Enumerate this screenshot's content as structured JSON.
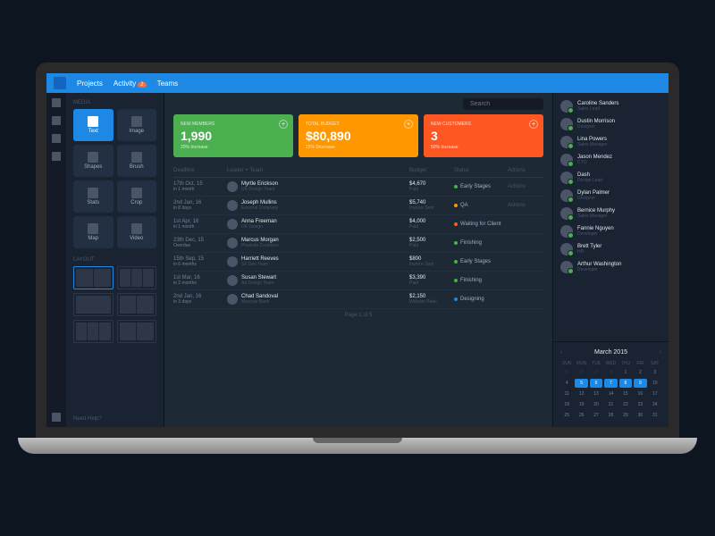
{
  "nav": {
    "items": [
      "Projects",
      "Activity",
      "Teams"
    ],
    "badge": "2"
  },
  "search": {
    "placeholder": "Search"
  },
  "tools": {
    "section": "Media",
    "items": [
      {
        "label": "Text",
        "active": true
      },
      {
        "label": "Image"
      },
      {
        "label": "Shapes"
      },
      {
        "label": "Brush"
      },
      {
        "label": "Stats"
      },
      {
        "label": "Crop"
      },
      {
        "label": "Map"
      },
      {
        "label": "Video"
      }
    ],
    "layoutSection": "Layout",
    "help": "Need Help?"
  },
  "cards": [
    {
      "label": "New Members",
      "value": "1,990",
      "trend": "20% Increase",
      "color": "green"
    },
    {
      "label": "Total Budget",
      "value": "$80,890",
      "trend": "15% Decrease",
      "color": "orange"
    },
    {
      "label": "New Customers",
      "value": "3",
      "trend": "50% Increase",
      "color": "red"
    }
  ],
  "table": {
    "headers": [
      "Deadline",
      "Leader + Team",
      "Budget",
      "Status",
      "Actions"
    ],
    "rows": [
      {
        "date": "17th Oct, 15",
        "sub": "in 1 month",
        "name": "Myrtle Erickson",
        "team": "UK Design Team",
        "budget": "$4,670",
        "bsub": "Paid",
        "status": "Early Stages",
        "dot": "#4caf50",
        "action": "Actions"
      },
      {
        "date": "2nd Jan, 16",
        "sub": "in 8 days",
        "name": "Joseph Mullins",
        "team": "External Company",
        "budget": "$5,740",
        "bsub": "Invoice Sent",
        "status": "QA",
        "dot": "#ff9800",
        "action": "Actions"
      },
      {
        "date": "1st Apr, 16",
        "sub": "in 1 month",
        "name": "Anna Freeman",
        "team": "UK Design",
        "budget": "$4,000",
        "bsub": "Paid",
        "status": "Waiting for Client",
        "dot": "#ff5722",
        "action": ""
      },
      {
        "date": "23th Dec, 15",
        "sub": "Overdue",
        "name": "Marcus Morgan",
        "team": "Pinacola Creatives",
        "budget": "$2,500",
        "bsub": "Paid",
        "status": "Finishing",
        "dot": "#4caf50",
        "action": ""
      },
      {
        "date": "15th Sep, 15",
        "sub": "in 6 months",
        "name": "Harriett Reeves",
        "team": "SF Dev Team",
        "budget": "$800",
        "bsub": "Invoice Sent",
        "status": "Early Stages",
        "dot": "#4caf50",
        "action": ""
      },
      {
        "date": "1st Mar, 16",
        "sub": "in 2 months",
        "name": "Susan Stewart",
        "team": "Ad Design Team",
        "budget": "$3,390",
        "bsub": "Paid",
        "status": "Finishing",
        "dot": "#4caf50",
        "action": ""
      },
      {
        "date": "2nd Jan, 16",
        "sub": "in 3 days",
        "name": "Chad Sandoval",
        "team": "Moscow Bank",
        "budget": "$2,150",
        "bsub": "Website Bank",
        "status": "Designing",
        "dot": "#1e88e5",
        "action": ""
      }
    ],
    "pager": "Page 1 of 5"
  },
  "members": [
    {
      "name": "Caroline Sanders",
      "role": "Sales Lead"
    },
    {
      "name": "Dustin Morrison",
      "role": "Designer"
    },
    {
      "name": "Lina Powers",
      "role": "Sales Manager"
    },
    {
      "name": "Jason Mendez",
      "role": "CTO"
    },
    {
      "name": "Dash",
      "role": "Design Lead"
    },
    {
      "name": "Dylan Palmer",
      "role": "Designer"
    },
    {
      "name": "Bernice Murphy",
      "role": "Sales Manager"
    },
    {
      "name": "Fannie Nguyen",
      "role": "Developer"
    },
    {
      "name": "Brett Tyler",
      "role": "HR"
    },
    {
      "name": "Arthur Washington",
      "role": "Developer"
    }
  ],
  "calendar": {
    "month": "March 2015",
    "dayHeaders": [
      "Sun",
      "Mon",
      "Tue",
      "Wed",
      "Thu",
      "Fri",
      "Sat"
    ],
    "days": [
      {
        "n": "25",
        "ot": true
      },
      {
        "n": "26",
        "ot": true
      },
      {
        "n": "27",
        "ot": true
      },
      {
        "n": "28",
        "ot": true
      },
      {
        "n": "1"
      },
      {
        "n": "2"
      },
      {
        "n": "3"
      },
      {
        "n": "4"
      },
      {
        "n": "5",
        "sel": true
      },
      {
        "n": "6",
        "sel": true
      },
      {
        "n": "7",
        "sel": true
      },
      {
        "n": "8",
        "sel": true
      },
      {
        "n": "9",
        "sel": true
      },
      {
        "n": "10"
      },
      {
        "n": "11"
      },
      {
        "n": "12"
      },
      {
        "n": "13"
      },
      {
        "n": "14"
      },
      {
        "n": "15"
      },
      {
        "n": "16"
      },
      {
        "n": "17"
      },
      {
        "n": "18"
      },
      {
        "n": "19"
      },
      {
        "n": "20"
      },
      {
        "n": "21"
      },
      {
        "n": "22"
      },
      {
        "n": "23"
      },
      {
        "n": "24"
      },
      {
        "n": "25"
      },
      {
        "n": "26"
      },
      {
        "n": "27"
      },
      {
        "n": "28"
      },
      {
        "n": "29"
      },
      {
        "n": "30"
      },
      {
        "n": "31"
      }
    ]
  }
}
